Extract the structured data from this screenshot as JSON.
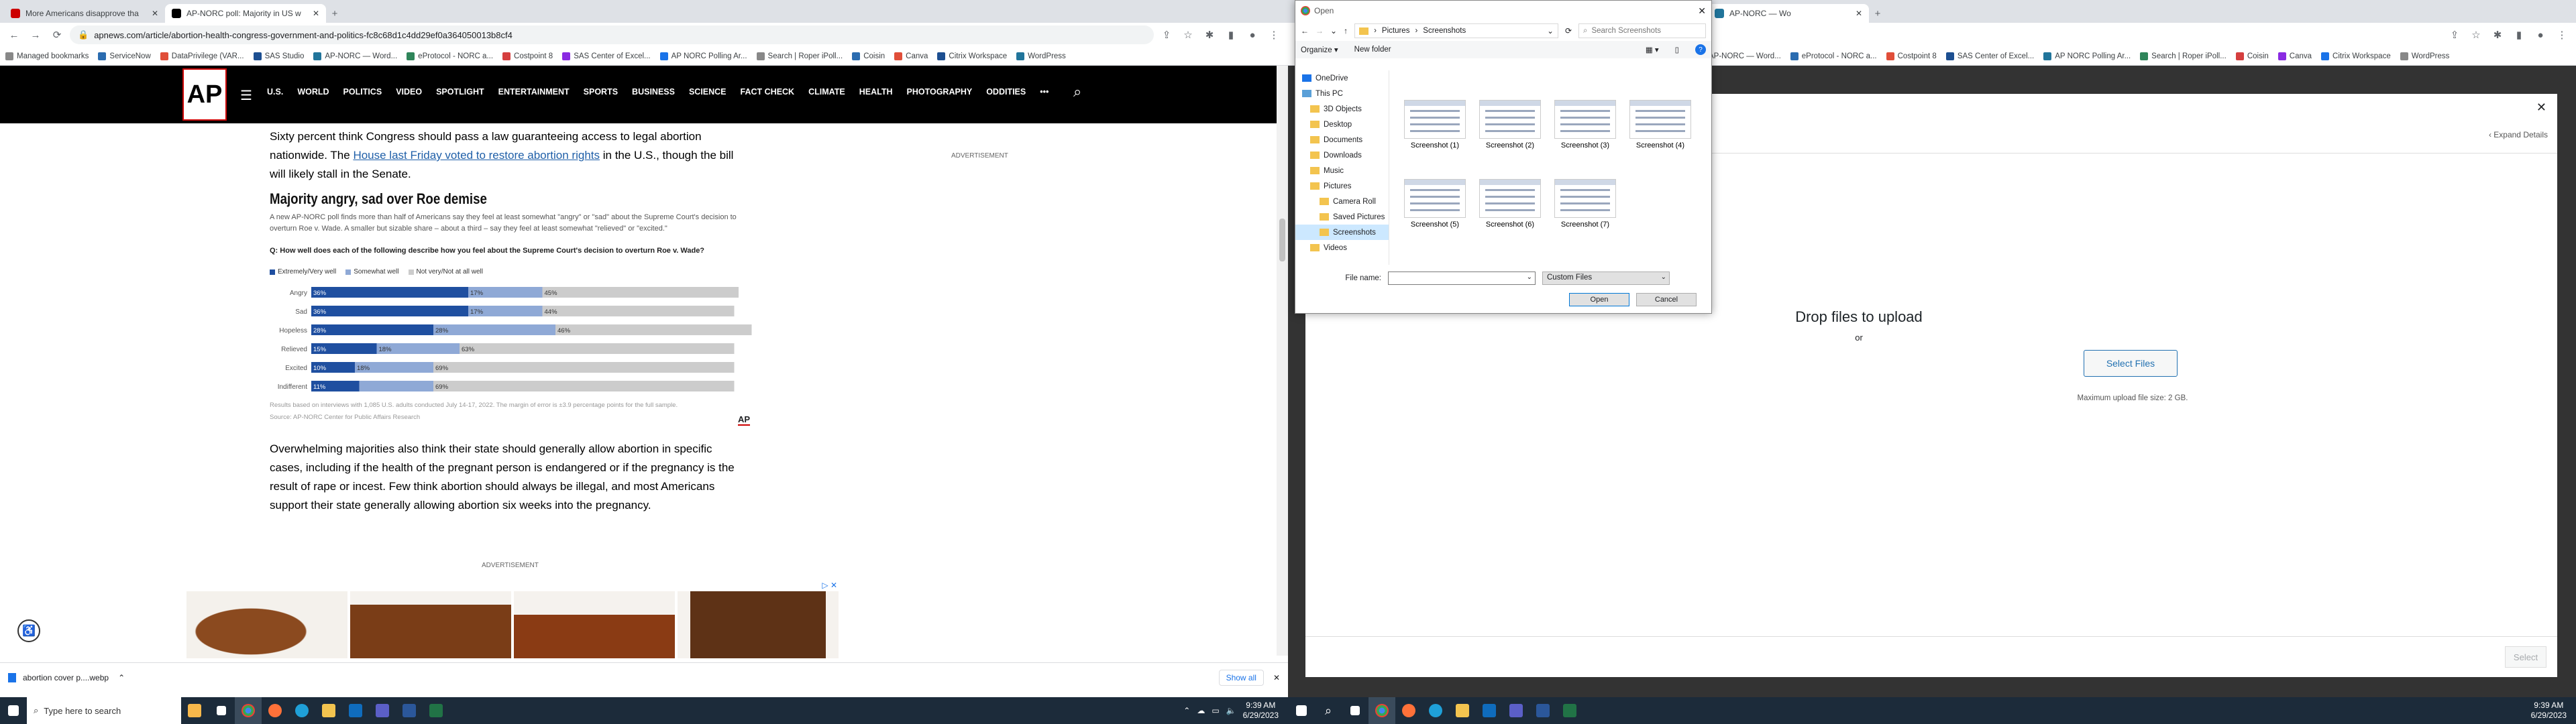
{
  "left": {
    "tabs": [
      {
        "title": "More Americans disapprove tha",
        "fav": "#c00"
      },
      {
        "title": "AP-NORC poll: Majority in US w",
        "fav": "#000"
      }
    ],
    "url": "apnews.com/article/abortion-health-congress-government-and-politics-fc8c68d1c4dd29ef0a364050013b8cf4",
    "bookmarks": [
      "Managed bookmarks",
      "ServiceNow",
      "DataPrivilege (VAR...",
      "SAS Studio",
      "AP-NORC — Word...",
      "eProtocol - NORC a...",
      "Costpoint 8",
      "SAS Center of Excel...",
      "AP NORC Polling Ar...",
      "Search | Roper iPoll...",
      "Coisin",
      "Canva",
      "Citrix Workspace",
      "WordPress"
    ],
    "nav": {
      "logo": "AP",
      "items": [
        "U.S.",
        "WORLD",
        "POLITICS",
        "VIDEO",
        "SPOTLIGHT",
        "ENTERTAINMENT",
        "SPORTS",
        "BUSINESS",
        "SCIENCE",
        "FACT CHECK",
        "CLIMATE",
        "HEALTH",
        "PHOTOGRAPHY",
        "ODDITIES",
        "•••"
      ]
    },
    "article": {
      "p1_a": "Sixty percent think Congress should pass a law guaranteeing access to legal abortion nationwide. The ",
      "p1_link": "House last Friday voted to restore abortion rights",
      "p1_b": " in the U.S., though the bill will likely stall in the Senate.",
      "ad_label_right": "ADVERTISEMENT",
      "chart_title": "Majority angry, sad over Roe demise",
      "chart_subtitle": "A new AP-NORC poll finds more than half of Americans say they feel at least somewhat \"angry\" or \"sad\" about the Supreme Court's decision to overturn Roe v. Wade. A smaller but sizable share – about a third – say they feel at least somewhat \"relieved\" or \"excited.\"",
      "chart_question": "Q: How well does each of the following describe how you feel about the Supreme Court's decision to overturn Roe v. Wade?",
      "chart_source": "Results based on interviews with 1,085 U.S. adults conducted July 14-17, 2022. The margin of error is ±3.9 percentage points for the full sample.",
      "chart_source2": "Source: AP-NORC Center for Public Affairs Research",
      "p2": "Overwhelming majorities also think their state should generally allow abortion in specific cases, including if the health of the pregnant person is endangered or if the pregnancy is the result of rape or incest. Few think abortion should always be illegal, and most Americans support their state generally allowing abortion six weeks into the pregnancy.",
      "ad_label": "ADVERTISEMENT"
    },
    "download": {
      "file": "abortion cover p....webp",
      "show_all": "Show all"
    }
  },
  "chart_data": {
    "type": "bar",
    "title": "Majority angry, sad over Roe demise",
    "categories": [
      "Angry",
      "Sad",
      "Hopeless",
      "Relieved",
      "Excited",
      "Indifferent"
    ],
    "series": [
      {
        "name": "Extremely/Very well",
        "color": "#1f4fa0",
        "values": [
          36,
          36,
          28,
          15,
          10,
          11
        ]
      },
      {
        "name": "Somewhat well",
        "color": "#8fa9d6",
        "values": [
          17,
          17,
          28,
          19,
          18,
          17
        ]
      },
      {
        "name": "Not very/Not at all well",
        "color": "#cccccc",
        "values": [
          45,
          44,
          45,
          63,
          69,
          69
        ]
      }
    ],
    "labels": [
      [
        "36%",
        "17%",
        "45%"
      ],
      [
        "36%",
        "17%",
        "44%"
      ],
      [
        "28%",
        "28%",
        "46%"
      ],
      [
        "15%",
        "18%",
        "63%"
      ],
      [
        "10%",
        "18%",
        "69%"
      ],
      [
        "11%",
        "",
        "69%"
      ]
    ],
    "xlim": [
      0,
      100
    ]
  },
  "open_dialog": {
    "title": "Open",
    "path": [
      "Pictures",
      "Screenshots"
    ],
    "search_placeholder": "Search Screenshots",
    "organize": "Organize ▾",
    "new_folder": "New folder",
    "tree": [
      "OneDrive",
      "This PC",
      "3D Objects",
      "Desktop",
      "Documents",
      "Downloads",
      "Music",
      "Pictures",
      "Camera Roll",
      "Saved Pictures",
      "Screenshots",
      "Videos"
    ],
    "files": [
      "Screenshot (1)",
      "Screenshot (2)",
      "Screenshot (3)",
      "Screenshot (4)",
      "Screenshot (5)",
      "Screenshot (6)",
      "Screenshot (7)"
    ],
    "filename_label": "File name:",
    "filetype": "Custom Files",
    "open": "Open",
    "cancel": "Cancel"
  },
  "right": {
    "tabs": [
      {
        "title": "AP-NORC — Wo",
        "fav": "#21759b"
      }
    ],
    "bookmarks": [
      "AP-NORC — Word...",
      "eProtocol - NORC a...",
      "Costpoint 8",
      "SAS Center of Excel...",
      "AP NORC Polling Ar...",
      "Search | Roper iPoll...",
      "Coisin",
      "Canva",
      "Citrix Workspace",
      "WordPress"
    ],
    "modal": {
      "expand": "‹ Expand Details",
      "drop": "Drop files to upload",
      "or": "or",
      "select_files": "Select Files",
      "max": "Maximum upload file size: 2 GB.",
      "select": "Select"
    }
  },
  "taskbar": {
    "search": "Type here to search",
    "time_left": "9:39 AM",
    "date_left": "6/29/2023",
    "time_right": "9:39 AM",
    "date_right": "6/29/2023"
  }
}
